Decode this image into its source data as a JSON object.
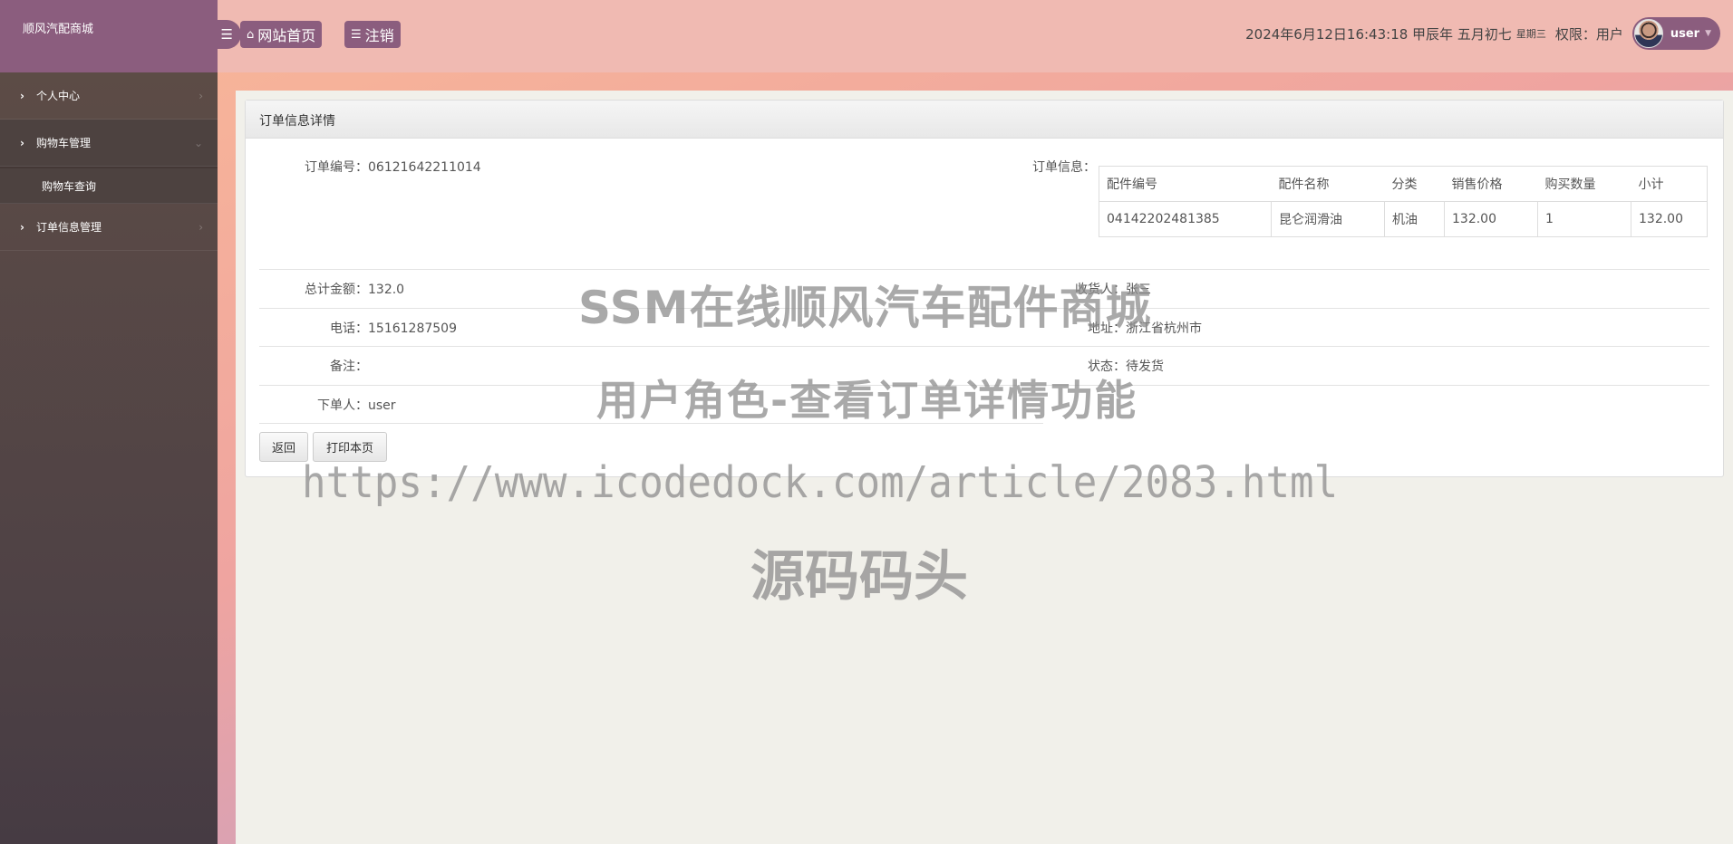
{
  "sidebar": {
    "brand": "顺风汽配商城",
    "items": [
      {
        "label": "个人中心",
        "expanded": false
      },
      {
        "label": "购物车管理",
        "expanded": true,
        "children": [
          {
            "label": "购物车查询"
          }
        ]
      },
      {
        "label": "订单信息管理",
        "expanded": false
      }
    ]
  },
  "header": {
    "toggle_icon": "bars-icon",
    "home_label": "网站首页",
    "logout_label": "注销",
    "datetime": "2024年6月12日16:43:18 甲辰年 五月初七",
    "weekday": "星期三",
    "permission": "权限：用户",
    "username": "user"
  },
  "panel": {
    "title": "订单信息详情",
    "order_no": {
      "label": "订单编号：",
      "value": "06121642211014"
    },
    "order_info_label": "订单信息：",
    "items_table": {
      "columns": [
        "配件编号",
        "配件名称",
        "分类",
        "销售价格",
        "购买数量",
        "小计"
      ],
      "rows": [
        [
          "04142202481385",
          "昆仑润滑油",
          "机油",
          "132.00",
          "1",
          "132.00"
        ]
      ]
    },
    "total": {
      "label": "总计金额：",
      "value": "132.0"
    },
    "receiver": {
      "label": "收货人：",
      "value": "张三"
    },
    "phone": {
      "label": "电话：",
      "value": "15161287509"
    },
    "address": {
      "label": "地址：",
      "value": "浙江省杭州市"
    },
    "remark": {
      "label": "备注：",
      "value": ""
    },
    "status": {
      "label": "状态：",
      "value": "待发货"
    },
    "orderer": {
      "label": "下单人：",
      "value": "user"
    },
    "back_label": "返回",
    "print_label": "打印本页"
  },
  "watermark": {
    "line1": "SSM在线顺风汽车配件商城",
    "line2": "用户角色-查看订单详情功能",
    "line3": "https://www.icodedock.com/article/2083.html",
    "line4": "源码码头"
  }
}
